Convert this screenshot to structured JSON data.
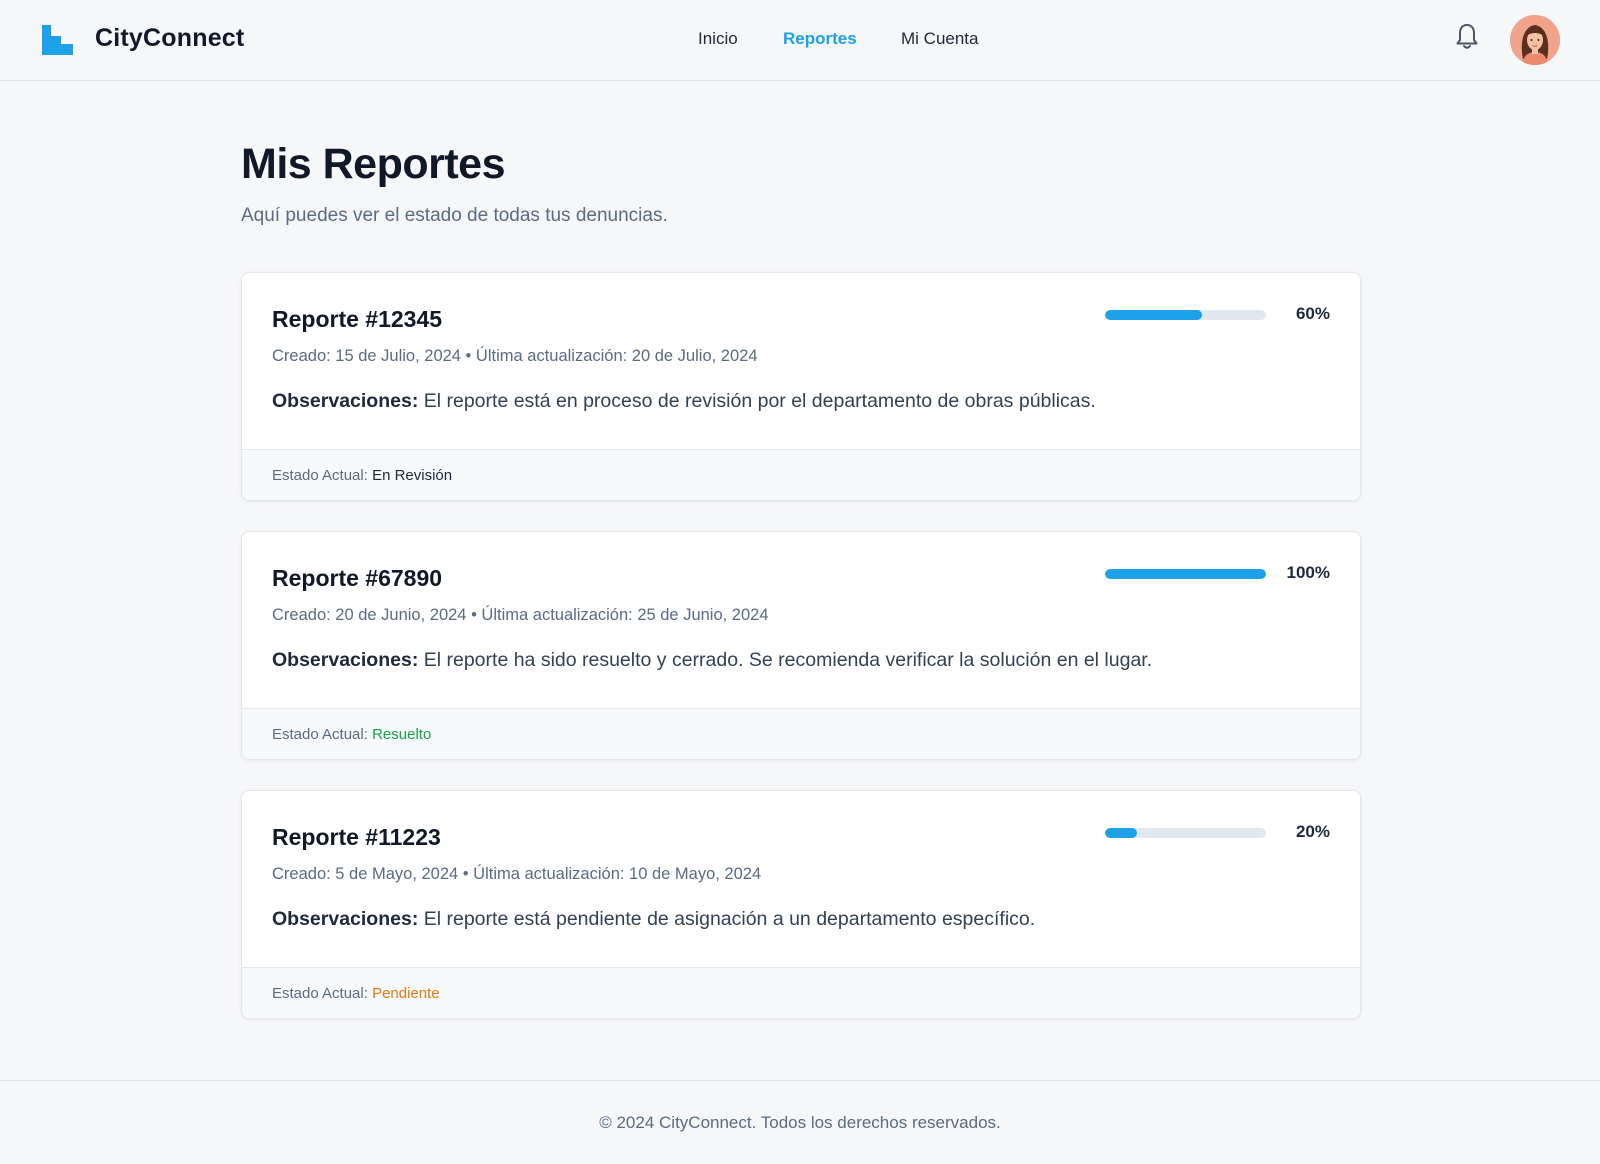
{
  "brand": {
    "name": "CityConnect",
    "logo_icon": "city-blocks-logo-icon",
    "accent": "#1da1e8"
  },
  "nav": {
    "items": [
      {
        "label": "Inicio",
        "active": false
      },
      {
        "label": "Reportes",
        "active": true
      },
      {
        "label": "Mi Cuenta",
        "active": false
      }
    ],
    "notifications_icon": "bell-icon",
    "avatar_icon": "user-avatar"
  },
  "main": {
    "title": "Mis Reportes",
    "subtitle": "Aquí puedes ver el estado de todas tus denuncias."
  },
  "reports": [
    {
      "title": "Reporte #12345",
      "meta": "Creado: 15 de Julio, 2024 • Última actualización: 20 de Julio, 2024",
      "obs_label": "Observaciones:",
      "obs_text": " El reporte está en proceso de revisión por el departamento de obras públicas.",
      "progress": 60,
      "progress_label": "60%",
      "status_label": "Estado Actual: ",
      "status_value": "En Revisión",
      "status_color": "#1e293b"
    },
    {
      "title": "Reporte #67890",
      "meta": "Creado: 20 de Junio, 2024 • Última actualización: 25 de Junio, 2024",
      "obs_label": "Observaciones:",
      "obs_text": " El reporte ha sido resuelto y cerrado. Se recomienda verificar la solución en el lugar.",
      "progress": 100,
      "progress_label": "100%",
      "status_label": "Estado Actual: ",
      "status_value": "Resuelto",
      "status_color": "#16a34a"
    },
    {
      "title": "Reporte #11223",
      "meta": "Creado: 5 de Mayo, 2024 • Última actualización: 10 de Mayo, 2024",
      "obs_label": "Observaciones:",
      "obs_text": " El reporte está pendiente de asignación a un departamento específico.",
      "progress": 20,
      "progress_label": "20%",
      "status_label": "Estado Actual: ",
      "status_value": "Pendiente",
      "status_color": "#e07b0f"
    }
  ],
  "footer": {
    "text": "© 2024 CityConnect. Todos los derechos reservados."
  }
}
